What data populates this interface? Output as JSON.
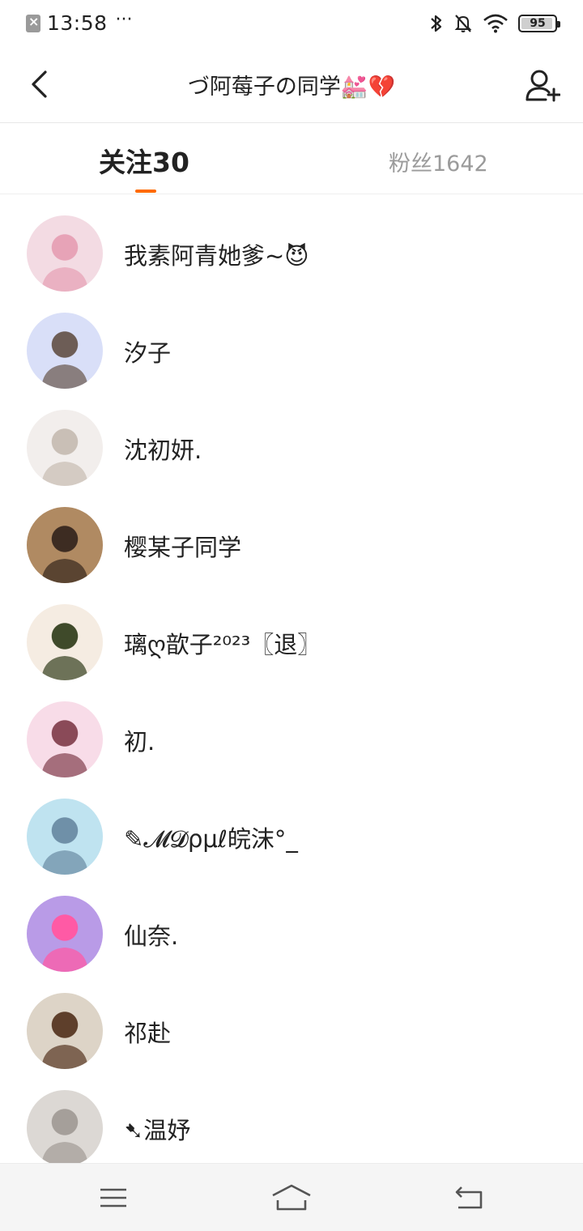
{
  "status_bar": {
    "time": "13:58",
    "more": "···",
    "battery": "95",
    "battery_level": 0.95,
    "icons": [
      "sim-disabled-icon",
      "bluetooth-icon",
      "mute-icon",
      "wifi-icon",
      "battery-icon"
    ]
  },
  "header": {
    "title": "づ阿莓子の同学💒💔",
    "back_icon": "back-icon",
    "add_icon": "add-user-icon"
  },
  "tabs": {
    "following": "关注30",
    "fans": "粉丝1642",
    "active": "following",
    "accent_color": "#ff6a00"
  },
  "list": [
    {
      "name": "我素阿青她爹~😈",
      "avatar_bg": "#f3dbe3",
      "avatar_fg": "#e7a3b7"
    },
    {
      "name": "汐子",
      "avatar_bg": "#d9dff8",
      "avatar_fg": "#6d5d56"
    },
    {
      "name": "沈初妍.",
      "avatar_bg": "#f2eeec",
      "avatar_fg": "#c9bfb6"
    },
    {
      "name": "樱某子同学",
      "avatar_bg": "#b08a62",
      "avatar_fg": "#3d2c22"
    },
    {
      "name": "璃ღ歆子²⁰²³〖退〗",
      "avatar_bg": "#f5ece2",
      "avatar_fg": "#3f4a2a"
    },
    {
      "name": "初.",
      "avatar_bg": "#f8dce8",
      "avatar_fg": "#8a4a58"
    },
    {
      "name": "✎𝓜𝓓ρμℓ皖沫°_",
      "avatar_bg": "#bfe3f0",
      "avatar_fg": "#6f90a8"
    },
    {
      "name": "仙奈.",
      "avatar_bg": "#b99be7",
      "avatar_fg": "#ff5aa5"
    },
    {
      "name": "祁赴",
      "avatar_bg": "#ddd4c7",
      "avatar_fg": "#5e3f2b"
    },
    {
      "name": "➷温妤",
      "avatar_bg": "#dcd8d4",
      "avatar_fg": "#a59f9a"
    }
  ],
  "bottom_nav": {
    "icons": [
      "menu-icon",
      "home-icon",
      "return-icon"
    ]
  }
}
